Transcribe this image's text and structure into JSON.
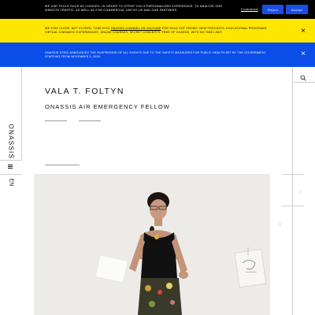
{
  "cookie_bar": {
    "text": "We use tools such as cookies, in order to offer you a personalized experience, to analyze our website traffic, as well as for commercial use by us and our partners.",
    "customize_label": "Customize",
    "reject_label": "Reject",
    "accept_label": "Accept"
  },
  "notice_yellow": {
    "text_before": "We stay close, not closed. Tune into",
    "link_text": "Onassis Channel on YouTube",
    "text_after": "for sold out shows, new podcasts, educational programs, virtual cinematic experiences, online courses, secret concerts. Free of charge, with no time limit."
  },
  "notice_blue": {
    "text": "Onassis Stegi announces the suspension of all events due to the safety measures for public health set by the government starting from November 3, 2020."
  },
  "left_rail": {
    "brand": "ONASSIS",
    "language": "EN",
    "menu_icon": "hamburger-menu-icon"
  },
  "right_rail": {
    "search_icon": "search-icon",
    "next_icon": "chevron-right-icon",
    "prev_icon": "chevron-left-icon"
  },
  "main": {
    "name": "VALA T. FOLTYN",
    "subtitle": "ONASSIS AIR EMERGENCY FELLOW"
  },
  "colors": {
    "cookie_bg": "#000000",
    "button_blue": "#1a4de6",
    "notice_yellow": "#ffe600",
    "notice_blue": "#0a4de8"
  }
}
